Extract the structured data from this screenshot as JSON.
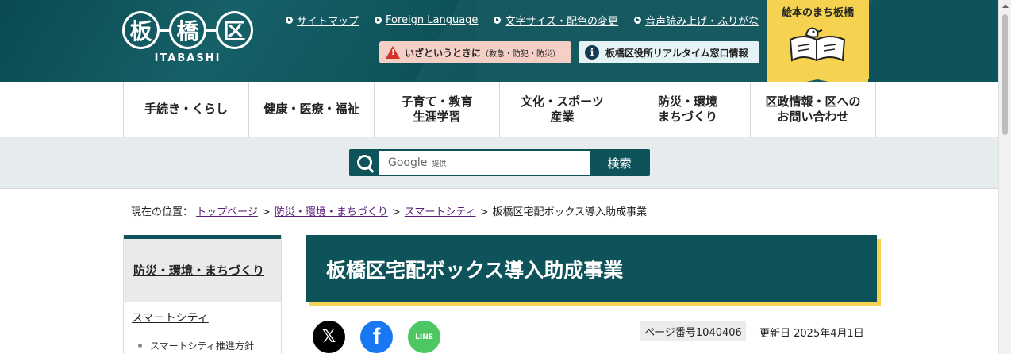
{
  "logo": {
    "kanji": [
      "板",
      "橋",
      "区"
    ],
    "roman": "ITABASHI"
  },
  "toplinks": [
    "サイトマップ",
    "Foreign Language",
    "文字サイズ・配色の変更",
    "音声読み上げ・ふりがな"
  ],
  "emergency": {
    "label": "いざというときに",
    "sub": "（救急・防犯・防災）"
  },
  "realtime": {
    "label": "板橋区役所リアルタイム窓口情報"
  },
  "ehon": {
    "label": "絵本のまち板橋"
  },
  "nav": [
    "手続き・くらし",
    "健康・医療・福祉",
    "子育て・教育\n生涯学習",
    "文化・スポーツ\n産業",
    "防災・環境\nまちづくり",
    "区政情報・区への\nお問い合わせ"
  ],
  "search": {
    "provider": "Google",
    "provided": "提供",
    "button": "検索"
  },
  "breadcrumb": {
    "prefix": "現在の位置：",
    "links": [
      "トップページ",
      "防災・環境・まちづくり",
      "スマートシティ"
    ],
    "current": "板橋区宅配ボックス導入助成事業",
    "sep": ">"
  },
  "sidebar": {
    "heading": "防災・環境・まちづくり",
    "section": "スマートシティ",
    "item": "スマートシティ推進方針"
  },
  "page": {
    "title": "板橋区宅配ボックス導入助成事業",
    "page_number": "ページ番号1040406",
    "updated": "更新日  2025年4月1日"
  },
  "social": {
    "x": "𝕏",
    "facebook": "f",
    "line": "LINE"
  }
}
